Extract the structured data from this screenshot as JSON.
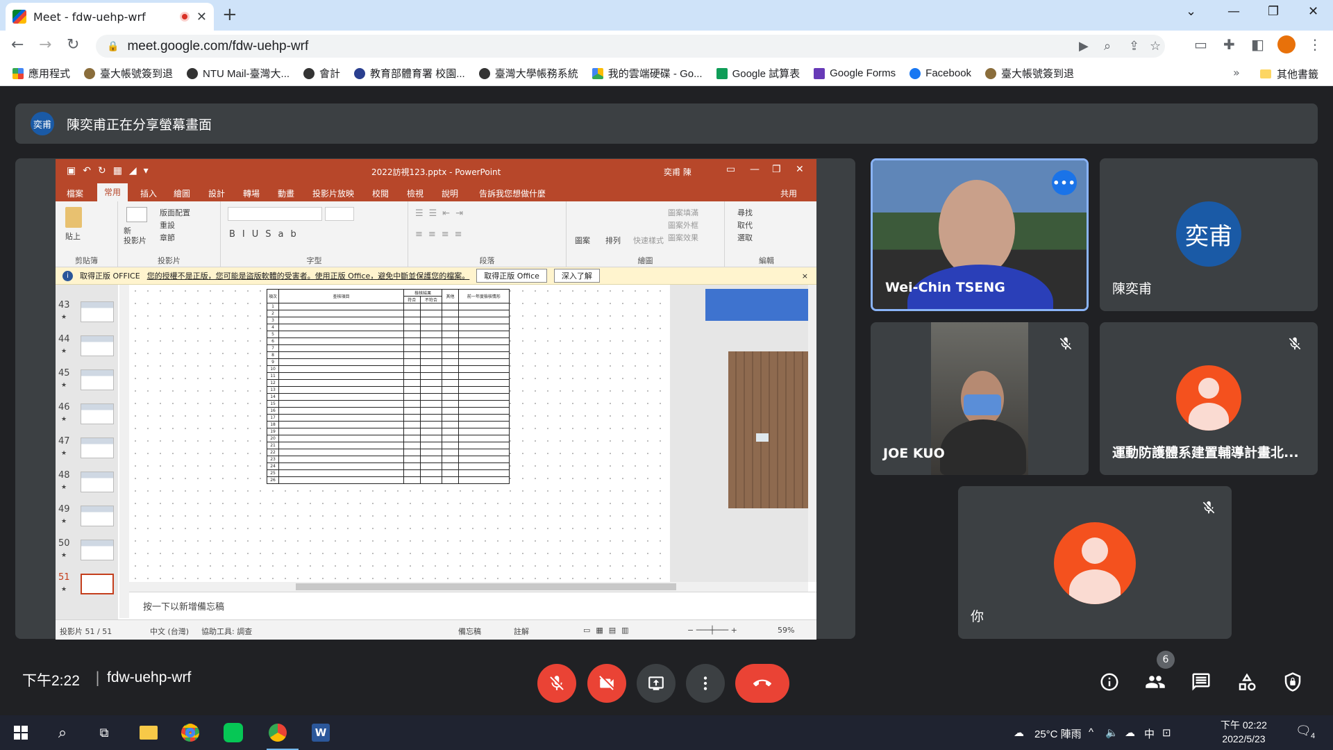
{
  "browser": {
    "tab_title": "Meet - fdw-uehp-wrf",
    "url": "meet.google.com/fdw-uehp-wrf",
    "bookmarks": [
      {
        "label": "應用程式",
        "icon": "apps-grid-icon"
      },
      {
        "label": "臺大帳號簽到退",
        "icon": "ntu-seal-icon"
      },
      {
        "label": "NTU Mail-臺灣大...",
        "icon": "globe-icon"
      },
      {
        "label": "會計",
        "icon": "globe-icon"
      },
      {
        "label": "教育部體育署 校園...",
        "icon": "moe-seal-icon"
      },
      {
        "label": "臺灣大學帳務系統",
        "icon": "globe-icon"
      },
      {
        "label": "我的雲端硬碟 - Go...",
        "icon": "drive-icon"
      },
      {
        "label": "Google 試算表",
        "icon": "sheets-icon"
      },
      {
        "label": "Google Forms",
        "icon": "forms-icon"
      },
      {
        "label": "Facebook",
        "icon": "facebook-icon"
      },
      {
        "label": "臺大帳號簽到退",
        "icon": "ntu-seal-icon"
      }
    ],
    "bookmarks_more": "»",
    "other_bookmarks": "其他書籤"
  },
  "meet": {
    "presenter_initials": "奕甫",
    "share_banner": "陳奕甫正在分享螢幕畫面",
    "time": "下午2:22",
    "separator": "|",
    "meeting_code": "fdw-uehp-wrf",
    "participant_count": "6",
    "participants": [
      {
        "name": "Wei-Chin TSENG",
        "type": "video",
        "speaking": true
      },
      {
        "name": "陳奕甫",
        "type": "avatar",
        "initials": "奕甫",
        "color": "#1a5aa6"
      },
      {
        "name": "JOE KUO",
        "type": "video",
        "muted": true
      },
      {
        "name": "運動防護體系建置輔導計畫北...",
        "type": "avatar",
        "color": "#f4511e",
        "muted": true
      },
      {
        "name": "你",
        "type": "avatar",
        "color": "#f4511e",
        "muted": true
      }
    ],
    "colors": {
      "accent": "#1a73e8",
      "danger": "#ea4335",
      "surface": "#3c4043"
    }
  },
  "powerpoint": {
    "title": "2022訪視123.pptx - PowerPoint",
    "user": "奕甫 陳",
    "menu": [
      "檔案",
      "常用",
      "插入",
      "繪圖",
      "設計",
      "轉場",
      "動畫",
      "投影片放映",
      "校閱",
      "檢視",
      "說明",
      "告訴我您想做什麼",
      "共用"
    ],
    "ribbon_groups": [
      "剪貼簿",
      "投影片",
      "字型",
      "段落",
      "繪圖",
      "編輯"
    ],
    "ribbon_items": {
      "paste": "貼上",
      "new_slide": "新\n投影片",
      "layout": "版面配置",
      "reset": "重設",
      "section": "章節",
      "shapes": "圖案",
      "arrange": "排列",
      "quick_styles": "快速樣式",
      "shape_fill": "圖案填滿",
      "shape_outline": "圖案外框",
      "shape_effects": "圖案效果",
      "find": "尋找",
      "replace": "取代",
      "select": "選取"
    },
    "warning": {
      "title": "取得正版 OFFICE",
      "message": "您的授權不是正版，您可能是盜版軟體的受害者。使用正版 Office，避免中斷並保護您的檔案。",
      "btn_get": "取得正版 Office",
      "btn_learn": "深入了解"
    },
    "thumbnails": [
      "43",
      "44",
      "45",
      "46",
      "47",
      "48",
      "49",
      "50",
      "51"
    ],
    "selected_slide": "51",
    "table_header": [
      "項次",
      "查核項目",
      "檢核結果",
      "其他",
      "前一年度檢核情形"
    ],
    "table_subheader": [
      "符合",
      "不符合"
    ],
    "table_rows": [
      "1",
      "2",
      "3",
      "4",
      "5",
      "6",
      "7",
      "8",
      "9",
      "10",
      "11",
      "12",
      "13",
      "14",
      "15",
      "16",
      "17",
      "18",
      "19",
      "20",
      "21",
      "22",
      "23",
      "24",
      "25",
      "26"
    ],
    "notes_placeholder": "按一下以新增備忘稿",
    "status": {
      "slide": "投影片 51 / 51",
      "lang": "中文 (台灣)",
      "accessibility": "協助工具: 調查",
      "notes": "備忘稿",
      "comments": "註解",
      "zoom": "59%"
    }
  },
  "taskbar": {
    "weather": "25°C 陣雨",
    "ime": "中",
    "clock_time": "下午 02:22",
    "clock_date": "2022/5/23",
    "notifications": "4"
  }
}
